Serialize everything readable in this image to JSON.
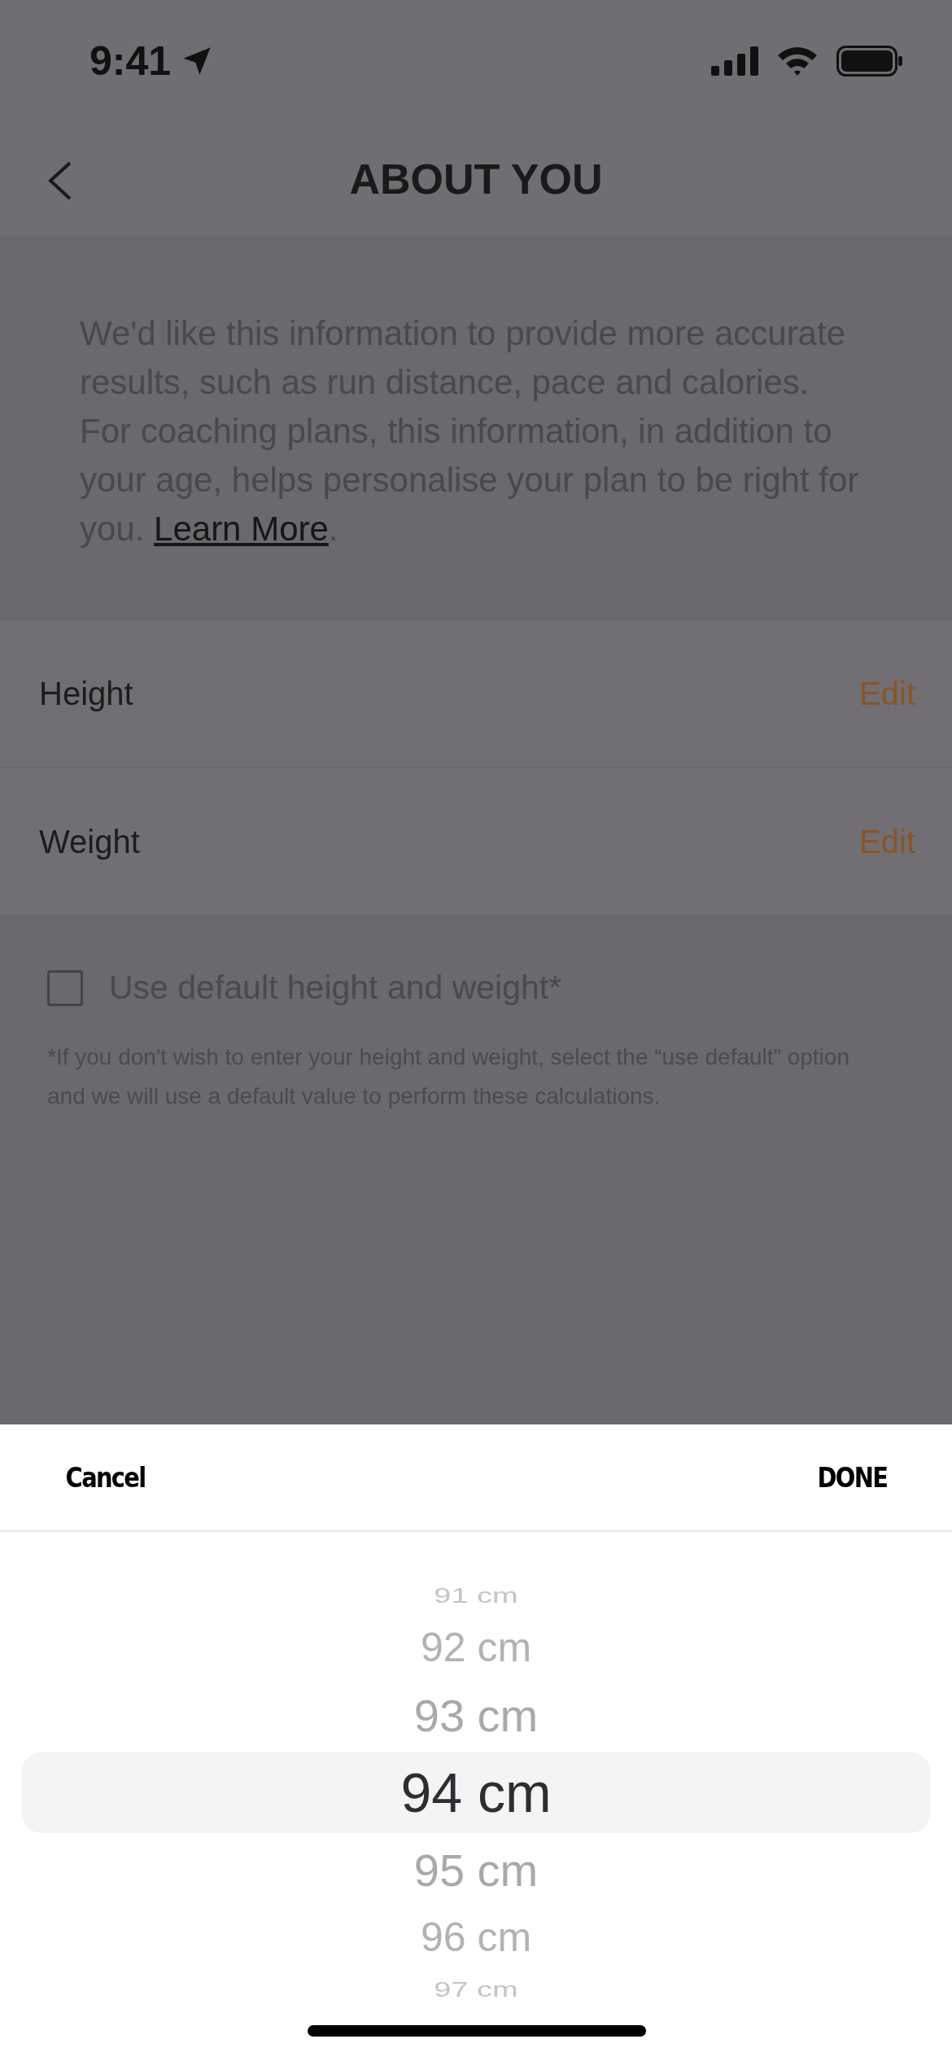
{
  "status_bar": {
    "time": "9:41"
  },
  "header": {
    "title": "ABOUT YOU"
  },
  "intro": {
    "text": "We'd like this information to provide more accurate results, such as run distance, pace and calories. For coaching plans, this information, in addition to your age, helps personalise your plan to be right for you. ",
    "link": "Learn More",
    "after": "."
  },
  "rows": [
    {
      "label": "Height",
      "action": "Edit"
    },
    {
      "label": "Weight",
      "action": "Edit"
    }
  ],
  "default_option": {
    "label": "Use default height and weight*",
    "checked": false
  },
  "footnote": "*If you don't wish to enter your height and weight, select the “use default” option and we will use a default value to perform these calculations.",
  "sheet": {
    "cancel": "Cancel",
    "done": "DONE",
    "picker": [
      {
        "label": "91 cm",
        "selected": false
      },
      {
        "label": "92 cm",
        "selected": false
      },
      {
        "label": "93 cm",
        "selected": false
      },
      {
        "label": "94 cm",
        "selected": true
      },
      {
        "label": "95 cm",
        "selected": false
      },
      {
        "label": "96 cm",
        "selected": false
      },
      {
        "label": "97 cm",
        "selected": false
      }
    ]
  }
}
